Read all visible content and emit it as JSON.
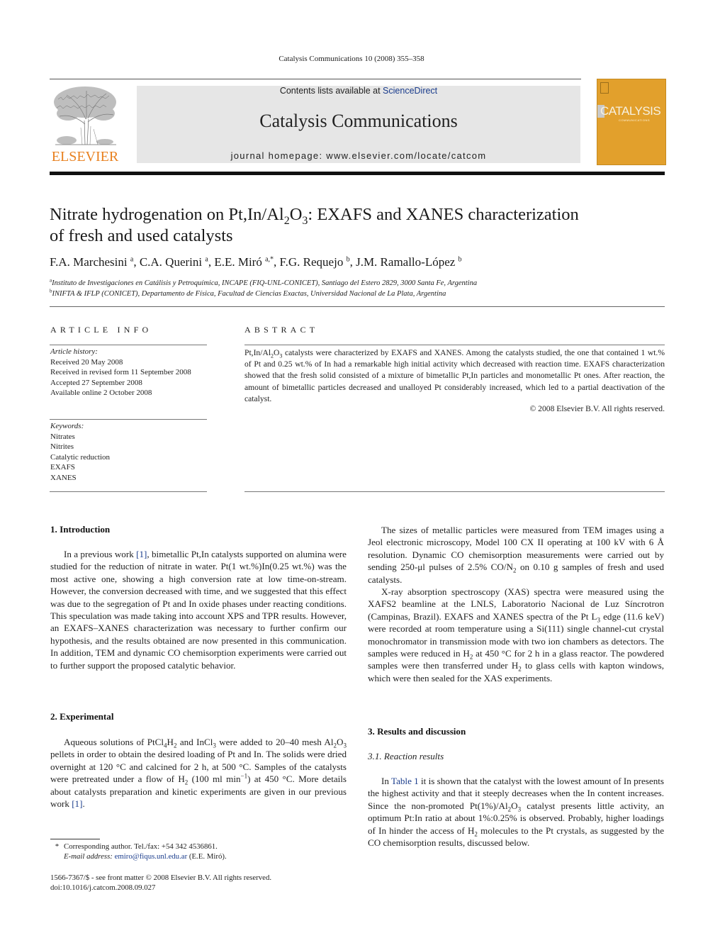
{
  "running_head": "Catalysis Communications 10 (2008) 355–358",
  "masthead": {
    "publisher_logo_text": "ELSEVIER",
    "contents_prefix": "Contents lists available at ",
    "contents_link": "ScienceDirect",
    "journal_name": "Catalysis Communications",
    "homepage": "journal homepage: www.elsevier.com/locate/catcom",
    "cover_title": "CATALYSIS",
    "cover_subtitle": "COMMUNICATIONS",
    "colors": {
      "elsevier_orange": "#e8801e",
      "cover_gold": "#e2a02c",
      "link_blue": "#1a3c8c",
      "masthead_gray": "#e6e6e6"
    }
  },
  "article": {
    "title_parts": {
      "t1": "Nitrate hydrogenation on Pt,In/Al",
      "sub1": "2",
      "t2": "O",
      "sub2": "3",
      "t3": ": EXAFS and XANES characterization",
      "t4": "of fresh and used catalysts"
    },
    "authors": [
      {
        "name": "F.A. Marchesini",
        "aff": "a"
      },
      {
        "name": "C.A. Querini",
        "aff": "a"
      },
      {
        "name": "E.E. Miró",
        "aff": "a,*"
      },
      {
        "name": "F.G. Requejo",
        "aff": "b"
      },
      {
        "name": "J.M. Ramallo-López",
        "aff": "b"
      }
    ],
    "affiliations": [
      {
        "mark": "a",
        "text": "Instituto de Investigaciones en Catálisis y Petroquímica, INCAPE (FIQ-UNL-CONICET), Santiago del Estero 2829, 3000 Santa Fe, Argentina"
      },
      {
        "mark": "b",
        "text": "INIFTA & IFLP (CONICET), Departamento de Física, Facultad de Ciencias Exactas, Universidad Nacional de La Plata, Argentina"
      }
    ]
  },
  "article_info": {
    "heading": "ARTICLE INFO",
    "history_label": "Article history:",
    "history": [
      "Received 20 May 2008",
      "Received in revised form 11 September 2008",
      "Accepted 27 September 2008",
      "Available online 2 October 2008"
    ],
    "keywords_label": "Keywords:",
    "keywords": [
      "Nitrates",
      "Nitrites",
      "Catalytic reduction",
      "EXAFS",
      "XANES"
    ]
  },
  "abstract": {
    "heading": "ABSTRACT",
    "a1": "Pt,In/Al",
    "a_sub1": "2",
    "a2": "O",
    "a_sub2": "3",
    "a3": " catalysts were characterized by EXAFS and XANES. Among the catalysts studied, the one that contained 1 wt.% of Pt and 0.25 wt.% of In had a remarkable high initial activity which decreased with reaction time. EXAFS characterization showed that the fresh solid consisted of a mixture of bimetallic Pt,In particles and monometallic Pt ones. After reaction, the amount of bimetallic particles decreased and unalloyed Pt considerably increased, which led to a partial deactivation of the catalyst.",
    "copyright": "© 2008 Elsevier B.V. All rights reserved."
  },
  "sections": {
    "intro": {
      "heading": "1. Introduction",
      "p1a": "In a previous work ",
      "ref1": "[1]",
      "p1b": ", bimetallic Pt,In catalysts supported on alumina were studied for the reduction of nitrate in water. Pt(1 wt.%)In(0.25 wt.%) was the most active one, showing a high conversion rate at low time-on-stream. However, the conversion decreased with time, and we suggested that this effect was due to the segregation of Pt and In oxide phases under reacting conditions. This speculation was made taking into account XPS and TPR results. However, an EXAFS–XANES characterization was necessary to further confirm our hypothesis, and the results obtained are now presented in this communication. In addition, TEM and dynamic CO chemisorption experiments were carried out to further support the proposed catalytic behavior."
    },
    "experimental": {
      "heading": "2. Experimental",
      "e1": "Aqueous solutions of PtCl",
      "e1s1": "4",
      "e2": "H",
      "e2s": "2",
      "e3": " and InCl",
      "e3s": "3",
      "e4": " were added to 20–40 mesh Al",
      "e4s": "2",
      "e5": "O",
      "e5s": "3",
      "e6": " pellets in order to obtain the desired loading of Pt and In. The solids were dried overnight at 120 °C and calcined for 2 h, at 500 °C. Samples of the catalysts were pretreated under a flow of H",
      "e6s": "2",
      "e7": " (100 ml min",
      "e7sup": "−1",
      "e8": ") at 450 °C. More details about catalysts preparation and kinetic experiments are given in our previous work ",
      "ref1": "[1]",
      "e9": "."
    },
    "methods_right": {
      "p1a": "The sizes of metallic particles were measured from TEM images using a Jeol electronic microscopy, Model 100 CX II operating at 100 kV with 6 Å resolution. Dynamic CO chemisorption measurements were carried out by sending 250-μl pulses of 2.5% CO/N",
      "p1s": "2",
      "p1b": " on 0.10 g samples of fresh and used catalysts.",
      "p2a": "X-ray absorption spectroscopy (XAS) spectra were measured using the XAFS2 beamline at the LNLS, Laboratorio Nacional de Luz Síncrotron (Campinas, Brazil). EXAFS and XANES spectra of the Pt L",
      "p2s1": "3",
      "p2b": " edge (11.6 keV) were recorded at room temperature using a Si(111) single channel-cut crystal monochromator in transmission mode with two ion chambers as detectors. The samples were reduced in H",
      "p2s2": "2",
      "p2c": " at 450 °C for 2 h in a glass reactor. The powdered samples were then transferred under H",
      "p2s3": "2",
      "p2d": " to glass cells with kapton windows, which were then sealed for the XAS experiments."
    },
    "results": {
      "heading": "3. Results and discussion",
      "subheading": "3.1. Reaction results",
      "r1": "In ",
      "table_ref": "Table 1",
      "r2": " it is shown that the catalyst with the lowest amount of In presents the highest activity and that it steeply decreases when the In content increases. Since the non-promoted Pt(1%)/Al",
      "r2s1": "2",
      "r3": "O",
      "r3s": "3",
      "r4": " catalyst presents little activity, an optimum Pt:In ratio at about 1%:0.25% is observed. Probably, higher loadings of In hinder the access of H",
      "r4s": "2",
      "r5": " molecules to the Pt crystals, as suggested by the CO chemisorption results, discussed below."
    }
  },
  "footnote": {
    "mark": "*",
    "corresponding": "Corresponding author. Tel./fax: +54 342 4536861.",
    "email_label": "E-mail address: ",
    "email": "emiro@fiqus.unl.edu.ar",
    "email_suffix": " (E.E. Miró)."
  },
  "front_matter": {
    "issn_line": "1566-7367/$ - see front matter © 2008 Elsevier B.V. All rights reserved.",
    "doi": "doi:10.1016/j.catcom.2008.09.027"
  }
}
